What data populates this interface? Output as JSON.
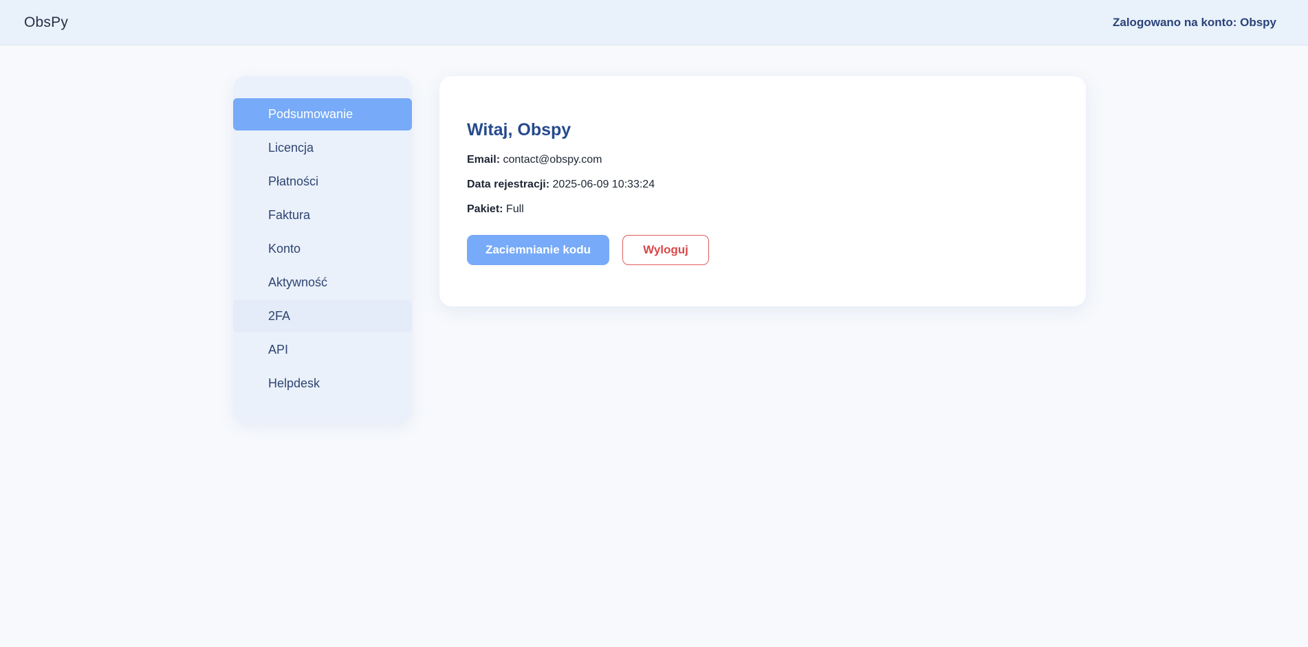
{
  "header": {
    "brand": "ObsPy",
    "account_text": "Zalogowano na konto: Obspy"
  },
  "sidebar": {
    "items": [
      {
        "label": "Podsumowanie",
        "active": true
      },
      {
        "label": "Licencja"
      },
      {
        "label": "Płatności"
      },
      {
        "label": "Faktura"
      },
      {
        "label": "Konto"
      },
      {
        "label": "Aktywność"
      },
      {
        "label": "2FA",
        "hover": true
      },
      {
        "label": "API"
      },
      {
        "label": "Helpdesk"
      }
    ]
  },
  "summary": {
    "greeting": "Witaj, Obspy",
    "email_label": "Email:",
    "email_value": "contact@obspy.com",
    "registration_label": "Data rejestracji:",
    "registration_value": "2025-06-09 10:33:24",
    "package_label": "Pakiet:",
    "package_value": "Full",
    "obfuscate_button": "Zaciemnianie kodu",
    "logout_button": "Wyloguj"
  },
  "colors": {
    "accent": "#77aaf8",
    "danger": "#d9484a",
    "heading": "#254a8e",
    "header_bg": "#e9f1fb"
  }
}
